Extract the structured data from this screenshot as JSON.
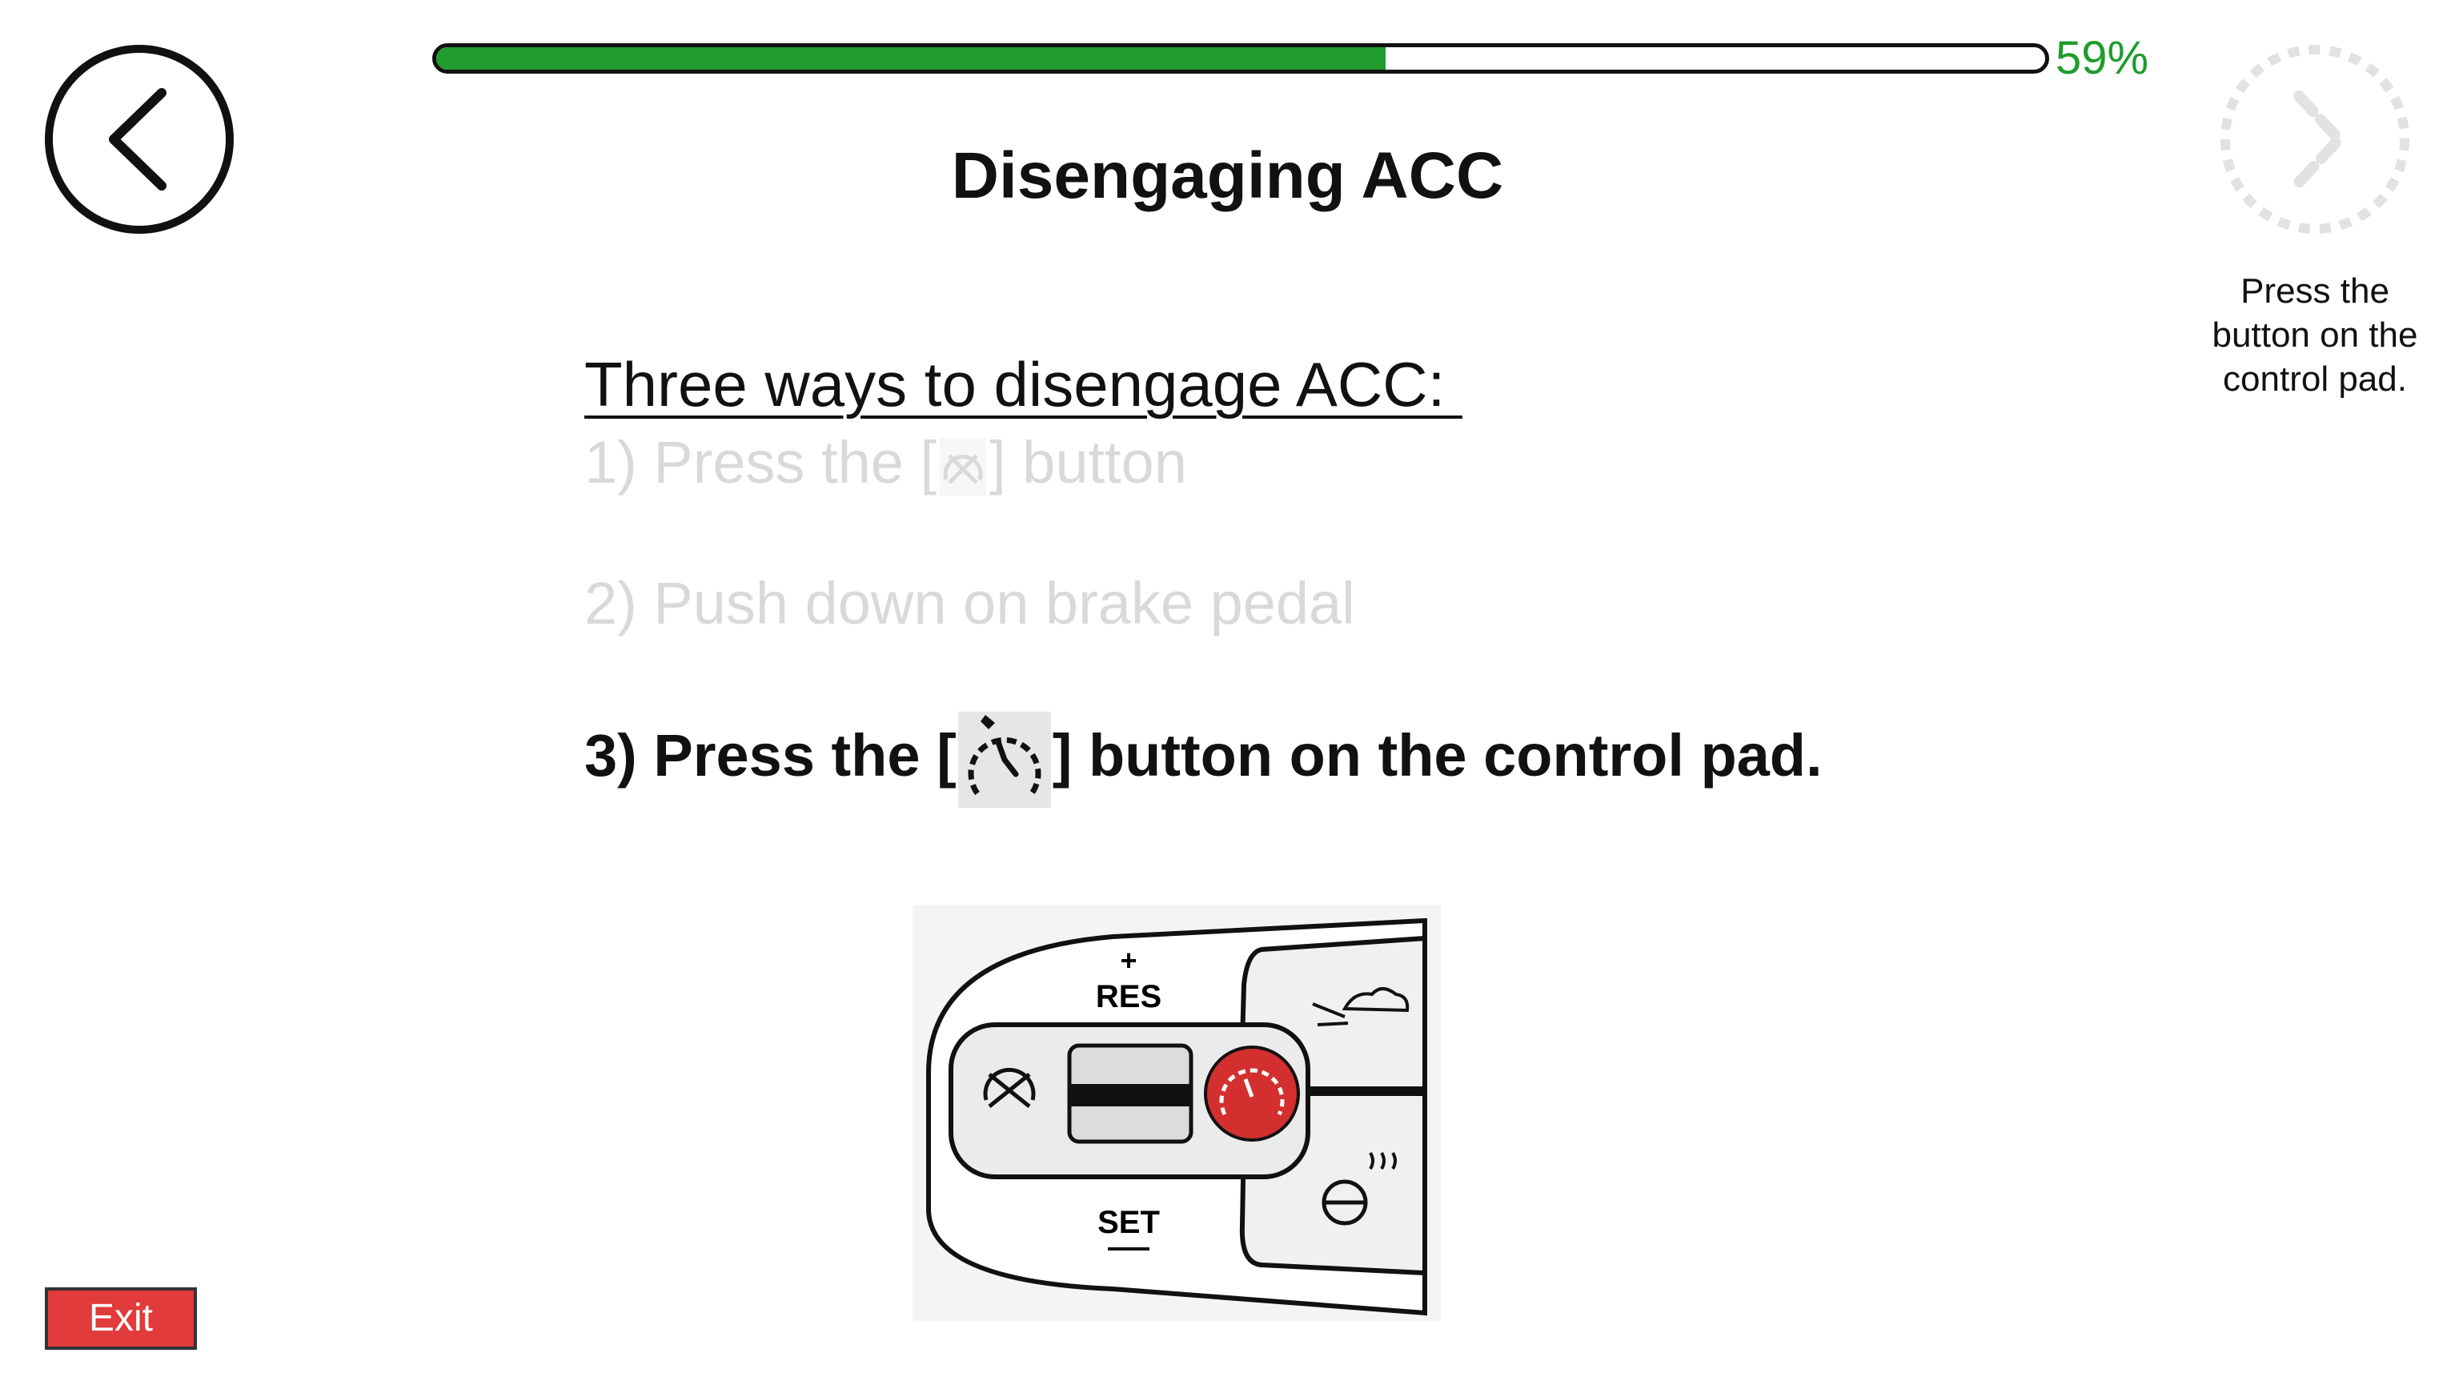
{
  "progress": {
    "value": 0.59,
    "label": "59%"
  },
  "title": "Disengaging ACC",
  "hint": "Press the button on the control pad.",
  "content": {
    "heading": "Three ways to disengage ACC: ",
    "step1": {
      "before": "1) Press the [",
      "after": "] button"
    },
    "step2": "2) Push down on brake pedal",
    "step3": {
      "before": "3) Press the [",
      "after": "] button on the control pad."
    }
  },
  "control_pad": {
    "top_label": "RES",
    "top_sign": "+",
    "bottom_label": "SET"
  },
  "exit_label": "Exit",
  "colors": {
    "progress": "#1f9c2b",
    "exit": "#e23b3b",
    "highlight": "#d32f2f"
  },
  "icons": {
    "back": "chevron-left-icon",
    "next": "chevron-right-icon",
    "step1": "cruise-control-off-icon",
    "step3": "cruise-control-cancel-icon"
  }
}
